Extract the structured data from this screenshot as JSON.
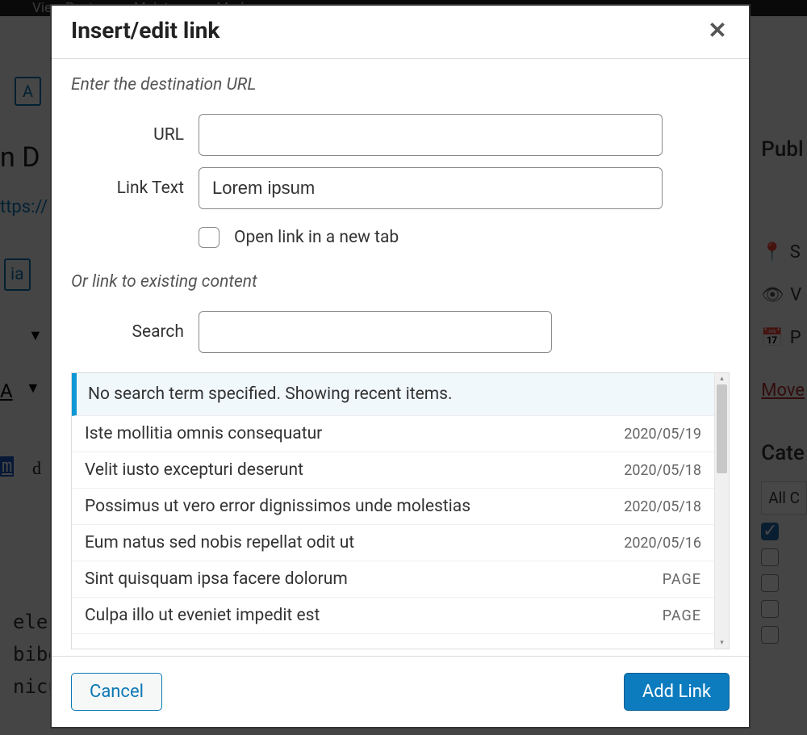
{
  "topbar": {
    "view_post": "View Post",
    "maintenance": "Maintenance Mode"
  },
  "bg": {
    "button_a": "A",
    "dsel": "n D",
    "url": "ttps://",
    "ia": "ia",
    "A": "A",
    "tri": "▼",
    "text1_hl": "m",
    "text1_rest": " d",
    "text2": "ele\nbiber\nnicul"
  },
  "right": {
    "publ": "Publ",
    "s": "S",
    "v": "V",
    "p": "P",
    "move": "Move",
    "cate": "Cate",
    "allc": "All C"
  },
  "dialog": {
    "title": "Insert/edit link",
    "close": "✕",
    "section1": "Enter the destination URL",
    "url_label": "URL",
    "url_value": "",
    "text_label": "Link Text",
    "text_value": "Lorem ipsum",
    "new_tab": "Open link in a new tab",
    "section2": "Or link to existing content",
    "search_label": "Search",
    "search_value": "",
    "results_header": "No search term specified. Showing recent items.",
    "results": [
      {
        "title": "Iste mollitia omnis consequatur",
        "meta": "2020/05/19",
        "type": "date"
      },
      {
        "title": "Velit iusto excepturi deserunt",
        "meta": "2020/05/18",
        "type": "date"
      },
      {
        "title": "Possimus ut vero error dignissimos unde molestias",
        "meta": "2020/05/18",
        "type": "date"
      },
      {
        "title": "Eum natus sed nobis repellat odit ut",
        "meta": "2020/05/16",
        "type": "date"
      },
      {
        "title": "Sint quisquam ipsa facere dolorum",
        "meta": "PAGE",
        "type": "page"
      },
      {
        "title": "Culpa illo ut eveniet impedit est",
        "meta": "PAGE",
        "type": "page"
      }
    ],
    "cancel": "Cancel",
    "submit": "Add Link"
  }
}
